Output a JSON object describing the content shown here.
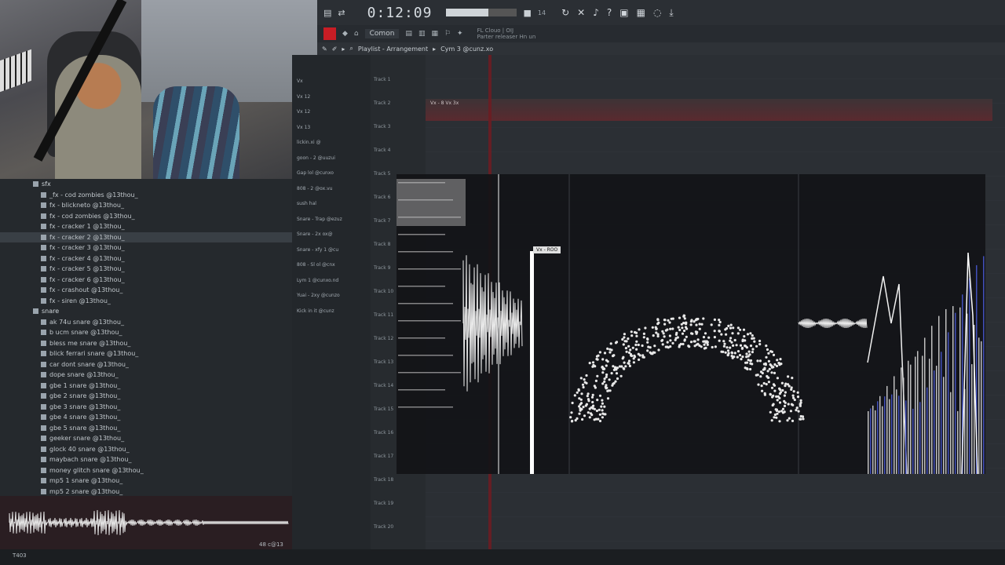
{
  "toolbar": {
    "time": "0:12:09",
    "tempo": "14"
  },
  "toolbar2": {
    "pattern": "Comon",
    "hint_line1": "FL Clouo | OIJ",
    "hint_line2": "Parter releaser Hn un"
  },
  "playlist_header": {
    "title": "Playlist - Arrangement",
    "path": "Cym 3 @cunz.xo"
  },
  "browser": {
    "folder_sfx": "sfx",
    "folder_snare": "snare",
    "sfx_items": [
      "_fx - cod zombies @13thou_",
      "fx - blickneto @13thou_",
      "fx - cod zombies @13thou_",
      "fx - cracker 1 @13thou_",
      "fx - cracker 2 @13thou_",
      "fx - cracker 3 @13thou_",
      "fx - cracker 4 @13thou_",
      "fx - cracker 5 @13thou_",
      "fx - cracker 6 @13thou_",
      "fx - crashout @13thou_",
      "fx - siren @13thou_"
    ],
    "snare_items": [
      "ak 74u snare @13thou_",
      "b ucm snare @13thou_",
      "bless me snare @13thou_",
      "blick ferrari snare @13thou_",
      "car dont snare @13thou_",
      "dope snare @13thou_",
      "gbe 1 snare @13thou_",
      "gbe 2 snare @13thou_",
      "gbe 3 snare @13thou_",
      "gbe 4 snare @13thou_",
      "gbe 5 snare @13thou_",
      "geeker snare @13thou_",
      "glock 40 snare @13thou_",
      "maybach snare @13thou_",
      "money glitch snare @13thou_",
      "mp5 1 snare @13thou_",
      "mp5 2 snare @13thou_"
    ]
  },
  "preview": {
    "left_label": "T403",
    "right_label": "48 c@13"
  },
  "channels": [
    "Vx",
    "Vx 12",
    "Vx 12",
    "Vx 13",
    "lickin.xi @",
    "goon - 2 @uuzui",
    "Gap lol @cunxo",
    "808 - 2 @ox.vu",
    "sush hal",
    "Snare - Trap @ezuz",
    "Snare - 2x ox@",
    "Snare - xfy 1 @cu",
    "808 - Sl ol @cnx",
    "Lym 1 @cunxo.nd",
    "Yuai - 2xy @cunzo",
    "Kick in it @cunz"
  ],
  "tracks": [
    "Track 1",
    "Track 2",
    "Track 3",
    "Track 4",
    "Track 5",
    "Track 6",
    "Track 7",
    "Track 8",
    "Track 9",
    "Track 10",
    "Track 11",
    "Track 12",
    "Track 13",
    "Track 14",
    "Track 15",
    "Track 16",
    "Track 17",
    "Track 18",
    "Track 19",
    "Track 20"
  ],
  "clip_label": "Vx - 8 Vx 3x",
  "viz": {
    "tag": "Vx - ROO"
  },
  "colors": {
    "accent_red": "#c81d25",
    "playhead": "#6b1d22",
    "clip": "#5a2a2f"
  }
}
